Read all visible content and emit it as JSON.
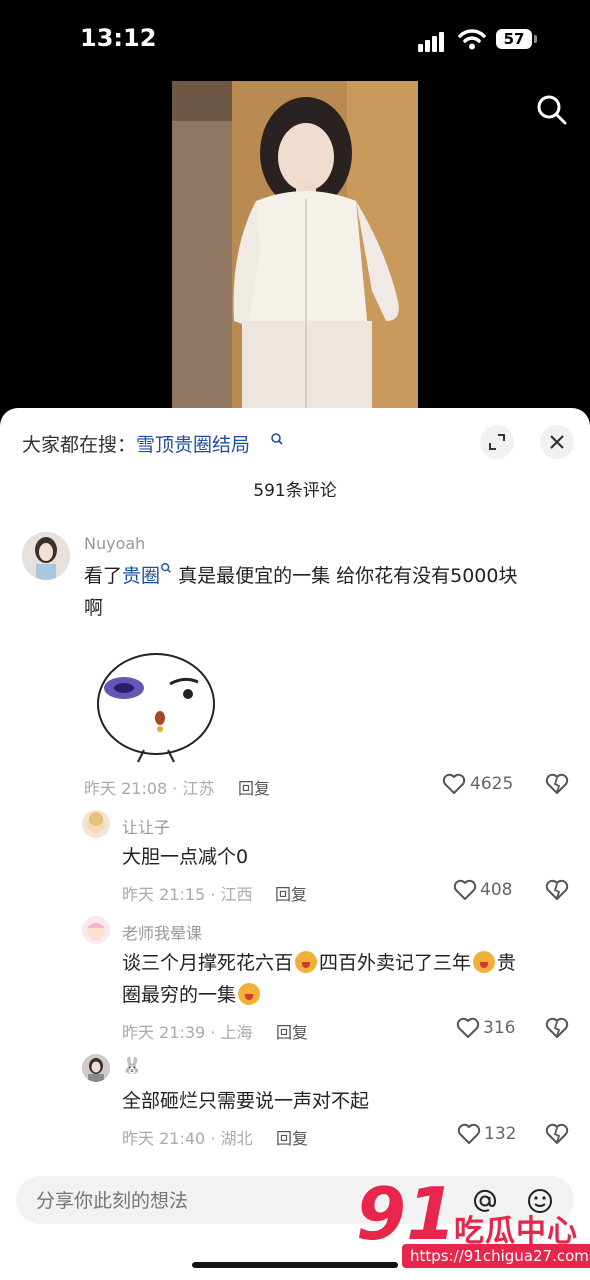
{
  "status_bar": {
    "time": "13:12",
    "battery": "57"
  },
  "sheet": {
    "hot_search_prefix": "大家都在搜：",
    "hot_search_term": "雪顶贵圈结局",
    "comment_count": "591条评论"
  },
  "comments": [
    {
      "user": "Nuyoah",
      "text_before": "看了",
      "link": "贵圈",
      "text_after": " 真是最便宜的一集 给你花有没有5000块",
      "text_line2": "啊",
      "time": "昨天 21:08 · 江苏",
      "reply": "回复",
      "likes": "4625"
    }
  ],
  "replies": [
    {
      "user": "让让子",
      "text": "大胆一点减个0",
      "time": "昨天 21:15 · 江西",
      "reply": "回复",
      "likes": "408"
    },
    {
      "user": "老师我晕课",
      "text_p1": "谈三个月撑死花六百",
      "text_p2": "四百外卖记了三年",
      "text_p3": "贵",
      "text_line2": "圈最穷的一集",
      "time": "昨天 21:39 · 上海",
      "reply": "回复",
      "likes": "316"
    },
    {
      "user": "🐰",
      "text": "全部砸烂只需要说一声对不起",
      "time": "昨天 21:40 · 湖北",
      "reply": "回复",
      "likes": "132"
    }
  ],
  "input": {
    "placeholder": "分享你此刻的想法"
  },
  "watermark": {
    "number": "91",
    "brand": "吃瓜中心",
    "url": "https://91chigua27.com"
  },
  "colors": {
    "link": "#1f4e9e",
    "watermark": "#e8254a"
  }
}
